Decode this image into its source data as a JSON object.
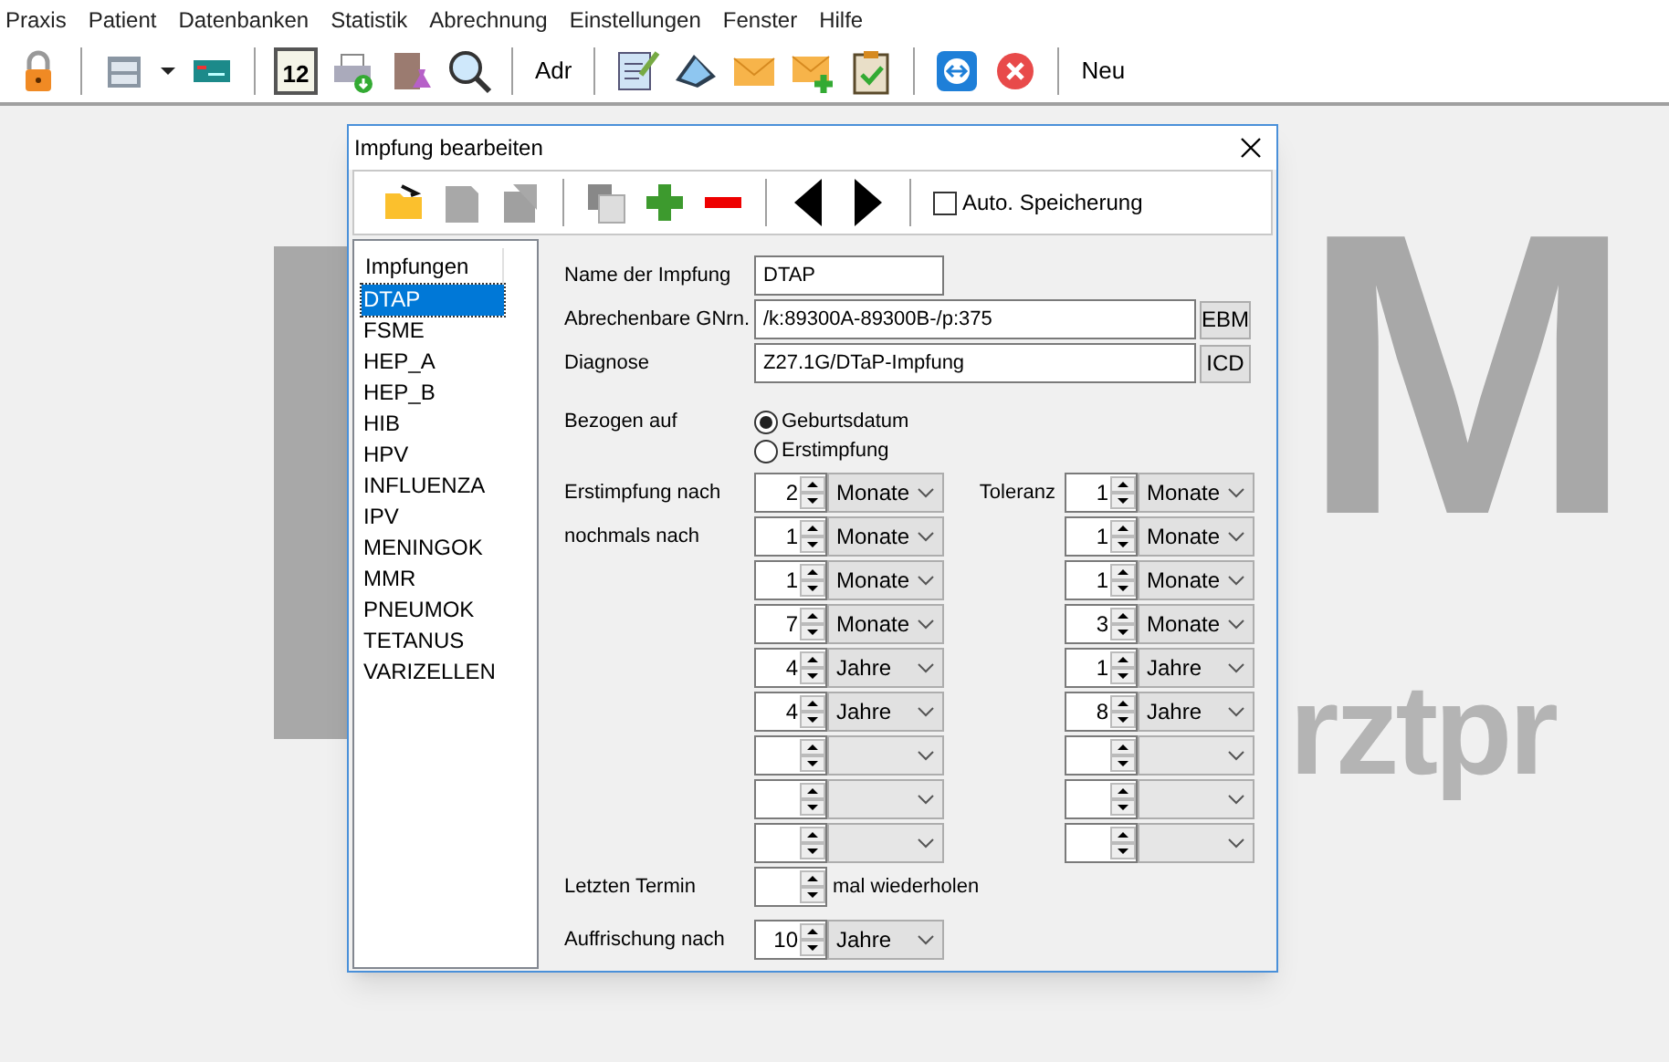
{
  "menu": [
    "Praxis",
    "Patient",
    "Datenbanken",
    "Statistik",
    "Abrechnung",
    "Einstellungen",
    "Fenster",
    "Hilfe"
  ],
  "toolbar": [
    {
      "kind": "lock"
    },
    {
      "kind": "sep"
    },
    {
      "kind": "cabinet"
    },
    {
      "kind": "caret"
    },
    {
      "kind": "card"
    },
    {
      "kind": "sep"
    },
    {
      "kind": "calendar",
      "text": "12"
    },
    {
      "kind": "printer"
    },
    {
      "kind": "lab"
    },
    {
      "kind": "search"
    },
    {
      "kind": "sep"
    },
    {
      "kind": "text",
      "text": "Adr"
    },
    {
      "kind": "sep"
    },
    {
      "kind": "note"
    },
    {
      "kind": "scanner"
    },
    {
      "kind": "mail"
    },
    {
      "kind": "mailplus"
    },
    {
      "kind": "clipboard"
    },
    {
      "kind": "sep"
    },
    {
      "kind": "remote"
    },
    {
      "kind": "close"
    },
    {
      "kind": "sep"
    },
    {
      "kind": "text",
      "text": "Neu"
    }
  ],
  "background_logo": {
    "mark": "M",
    "caption": "rztpr"
  },
  "dialog": {
    "title": "Impfung bearbeiten",
    "toolbar": [
      {
        "kind": "open"
      },
      {
        "kind": "page"
      },
      {
        "kind": "pages"
      },
      {
        "kind": "sep"
      },
      {
        "kind": "copy"
      },
      {
        "kind": "plus"
      },
      {
        "kind": "minus"
      },
      {
        "kind": "sep"
      },
      {
        "kind": "left"
      },
      {
        "kind": "right"
      },
      {
        "kind": "sep"
      }
    ],
    "auto_save": {
      "label": "Auto. Speicherung",
      "checked": false
    },
    "list": {
      "header": "Impfungen",
      "items": [
        {
          "label": "DTAP",
          "selected": true
        },
        {
          "label": "FSME",
          "selected": false
        },
        {
          "label": "HEP_A",
          "selected": false
        },
        {
          "label": "HEP_B",
          "selected": false
        },
        {
          "label": "HIB",
          "selected": false
        },
        {
          "label": "HPV",
          "selected": false
        },
        {
          "label": "INFLUENZA",
          "selected": false
        },
        {
          "label": "IPV",
          "selected": false
        },
        {
          "label": "MENINGOK",
          "selected": false
        },
        {
          "label": "MMR",
          "selected": false
        },
        {
          "label": "PNEUMOK",
          "selected": false
        },
        {
          "label": "TETANUS",
          "selected": false
        },
        {
          "label": "VARIZELLEN",
          "selected": false
        }
      ]
    },
    "name": {
      "label": "Name der Impfung",
      "value": "DTAP"
    },
    "gnr": {
      "label": "Abrechenbare GNrn.",
      "value": "/k:89300A-89300B-/p:375",
      "button": "EBM"
    },
    "diagnose": {
      "label": "Diagnose",
      "value": "Z27.1G/DTaP-Impfung",
      "button": "ICD"
    },
    "bezogen": {
      "label": "Bezogen auf",
      "options": [
        {
          "label": "Geburtsdatum",
          "selected": true
        },
        {
          "label": "Erstimpfung",
          "selected": false
        }
      ]
    },
    "tolerance_label": "Toleranz",
    "schedule": [
      {
        "kind": "set",
        "label": "Erstimpfung nach",
        "value": "2",
        "unit": "Monate",
        "tol_value": "1",
        "tol_unit": "Monate"
      },
      {
        "kind": "set",
        "label": "nochmals nach",
        "value": "1",
        "unit": "Monate",
        "tol_value": "1",
        "tol_unit": "Monate"
      },
      {
        "kind": "set",
        "value": "1",
        "unit": "Monate",
        "tol_value": "1",
        "tol_unit": "Monate"
      },
      {
        "kind": "set",
        "value": "7",
        "unit": "Monate",
        "tol_value": "3",
        "tol_unit": "Monate"
      },
      {
        "kind": "set",
        "value": "4",
        "unit": "Jahre",
        "tol_value": "1",
        "tol_unit": "Jahre"
      },
      {
        "kind": "set",
        "value": "4",
        "unit": "Jahre",
        "tol_value": "8",
        "tol_unit": "Jahre"
      },
      {
        "kind": "blank"
      },
      {
        "kind": "blank"
      },
      {
        "kind": "blank"
      }
    ],
    "last": {
      "label": "Letzten Termin",
      "suffix": "mal wiederholen"
    },
    "refresh": {
      "label": "Auffrischung nach",
      "value": "10",
      "unit": "Jahre"
    }
  }
}
